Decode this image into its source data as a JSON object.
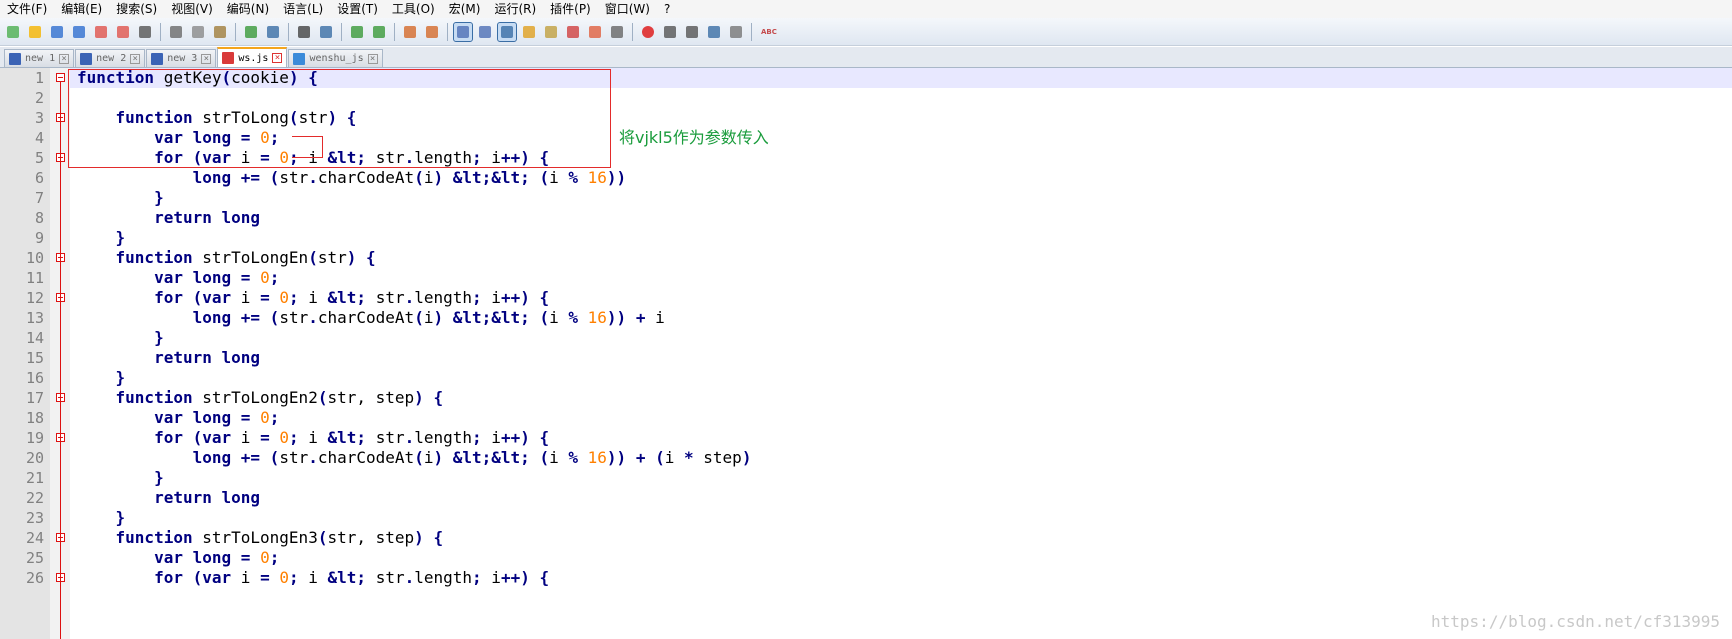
{
  "menu": [
    "文件(F)",
    "编辑(E)",
    "搜索(S)",
    "视图(V)",
    "编码(N)",
    "语言(L)",
    "设置(T)",
    "工具(O)",
    "宏(M)",
    "运行(R)",
    "插件(P)",
    "窗口(W)",
    "?"
  ],
  "toolbar_icons": [
    "new-file-icon",
    "open-file-icon",
    "save-icon",
    "save-all-icon",
    "close-icon",
    "close-all-icon",
    "print-icon",
    "sep",
    "cut-icon",
    "copy-icon",
    "paste-icon",
    "sep",
    "undo-icon",
    "redo-icon",
    "sep",
    "find-icon",
    "replace-icon",
    "sep",
    "zoom-in-icon",
    "zoom-out-icon",
    "sep",
    "sync-v-icon",
    "sync-h-icon",
    "sep",
    "word-wrap-icon",
    "show-all-chars-icon",
    "indent-guide-icon",
    "udl-icon",
    "doc-map-icon",
    "function-list-icon",
    "folder-workspace-icon",
    "monitor-icon",
    "sep",
    "record-macro-icon",
    "stop-macro-icon",
    "play-macro-icon",
    "run-macro-multiple-icon",
    "save-macro-icon",
    "sep",
    "spellcheck-icon"
  ],
  "tabs": [
    {
      "label": "new 1",
      "active": false,
      "color": "#3b63b5"
    },
    {
      "label": "new 2",
      "active": false,
      "color": "#3b63b5"
    },
    {
      "label": "new 3",
      "active": false,
      "color": "#3b63b5"
    },
    {
      "label": "ws.js",
      "active": true,
      "color": "#d93a3a"
    },
    {
      "label": "wenshu_js",
      "active": false,
      "color": "#3b8bd9"
    }
  ],
  "line_numbers": [
    "1",
    "2",
    "3",
    "4",
    "5",
    "6",
    "7",
    "8",
    "9",
    "10",
    "11",
    "12",
    "13",
    "14",
    "15",
    "16",
    "17",
    "18",
    "19",
    "20",
    "21",
    "22",
    "23",
    "24",
    "25",
    "26"
  ],
  "code": {
    "l1": {
      "kw": "function",
      "rest": " getKey(cookie) {"
    },
    "l3": {
      "kw": "function",
      "rest": " strToLong(str) {"
    },
    "l4": {
      "kw": "var",
      "kw2": "long",
      "rest": " = ",
      "num": "0",
      ";": ";"
    },
    "l5": {
      "text_a": "for (",
      "kw": "var",
      "text_b": " i = ",
      "num": "0",
      "text_c": "; i < str.length; i++) {"
    },
    "l6": {
      "kw": "long",
      "text_a": " += (str.charCodeAt(i) << (i % ",
      "num": "16",
      "text_b": "))"
    },
    "l7": "}",
    "l8": {
      "kw": "return",
      "kw2": "long"
    },
    "l9": "}",
    "l10": {
      "kw": "function",
      "rest": " strToLongEn(str) {"
    },
    "l13_tail": ")) + i",
    "l17": {
      "kw": "function",
      "rest": " strToLongEn2(str, step) {"
    },
    "l20_tail": ")) + (i * step)",
    "l24": {
      "kw": "function",
      "rest": " strToLongEn3(str, step) {"
    }
  },
  "annotation": "将vjkl5作为参数传入",
  "watermark": "https://blog.csdn.net/cf313995"
}
